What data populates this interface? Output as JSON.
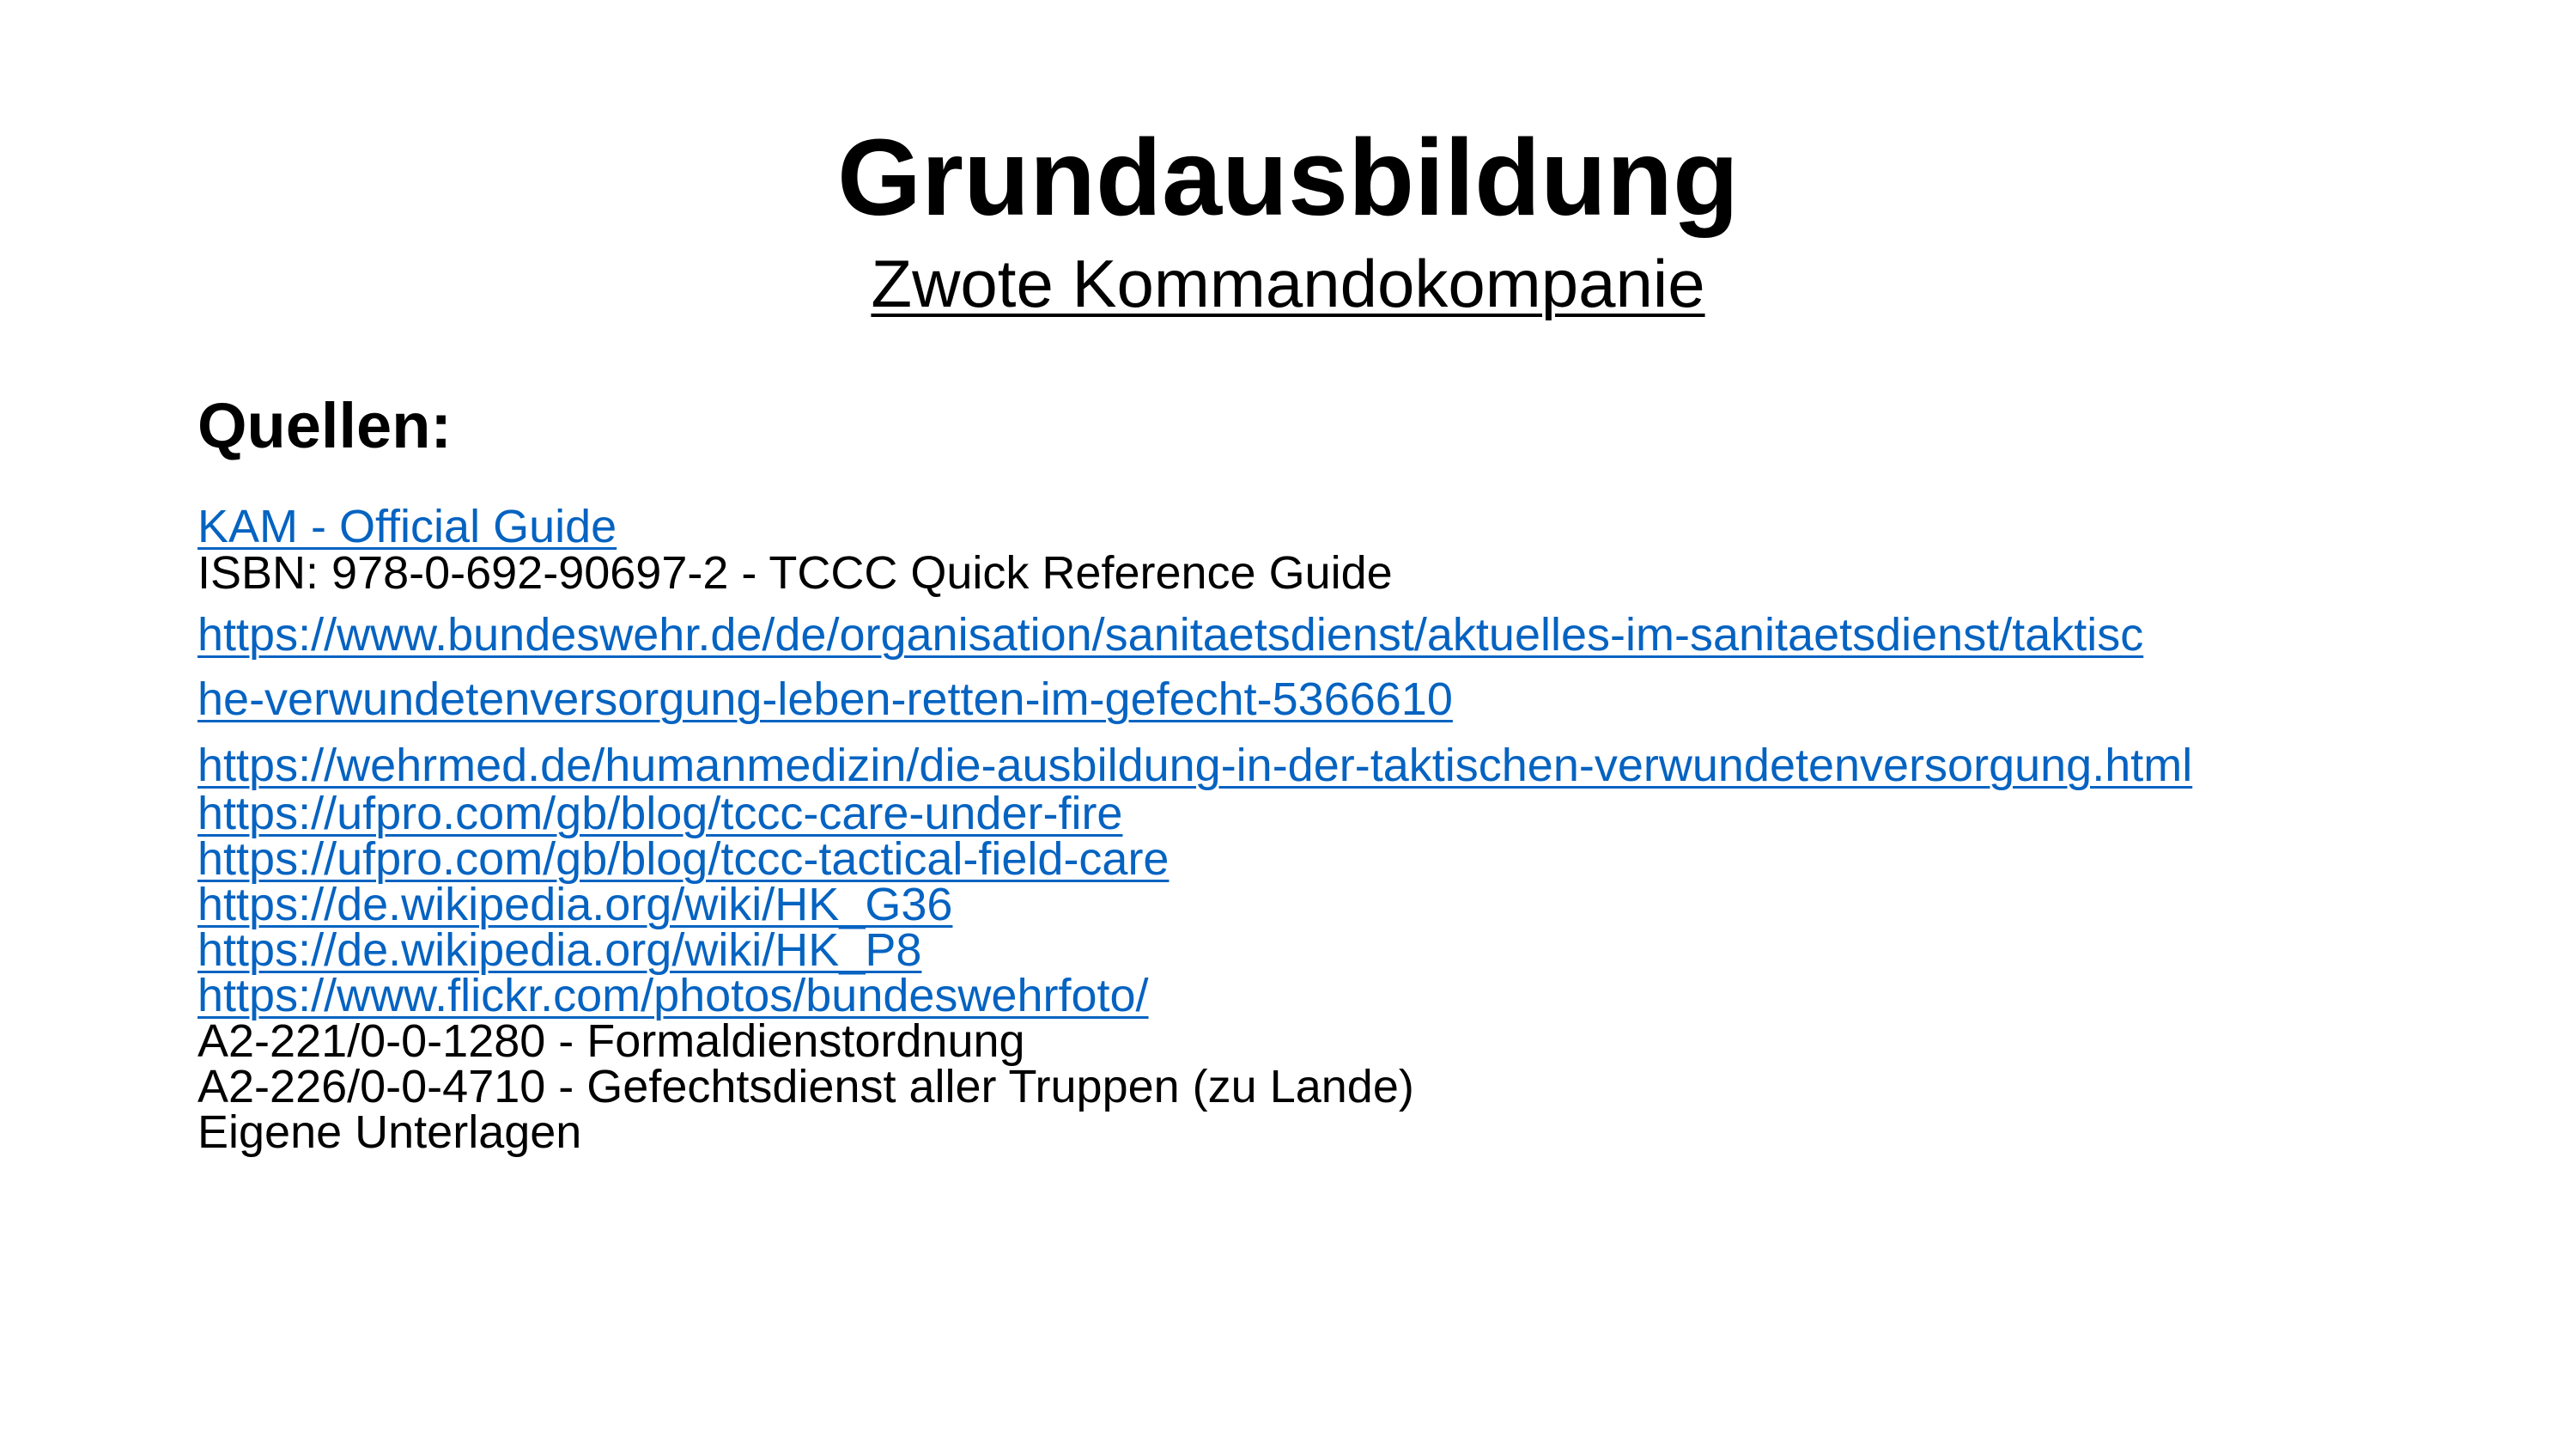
{
  "slide": {
    "title": "Grundausbildung",
    "subtitle": "Zwote Kommandokompanie",
    "heading": "Quellen:",
    "sources": {
      "kam_guide": "KAM - Official Guide",
      "isbn_tccc": "ISBN: 978-0-692-90697-2 - TCCC Quick Reference Guide",
      "bundeswehr_url_part1": "https://www.bundeswehr.de/de/organisation/sanitaetsdienst/aktuelles-im-sanitaetsdienst/taktisc",
      "bundeswehr_url_part2": "he-verwundetenversorgung-leben-retten-im-gefecht-5366610",
      "wehrmed_url": "https://wehrmed.de/humanmedizin/die-ausbildung-in-der-taktischen-verwundetenversorgung.html",
      "ufpro_care_under_fire": "https://ufpro.com/gb/blog/tccc-care-under-fire",
      "ufpro_tactical_field_care": "https://ufpro.com/gb/blog/tccc-tactical-field-care",
      "wiki_g36": "https://de.wikipedia.org/wiki/HK_G36",
      "wiki_p8": "https://de.wikipedia.org/wiki/HK_P8",
      "flickr": "https://www.flickr.com/photos/bundeswehrfoto/",
      "formaldienst": "A2-221/0-0-1280 - Formaldienstordnung",
      "gefechtsdienst": "A2-226/0-0-4710 - Gefechtsdienst aller Truppen (zu Lande)",
      "eigene": "Eigene Unterlagen"
    }
  },
  "colors": {
    "link": "#0563c1",
    "text": "#000000",
    "background": "#ffffff"
  }
}
